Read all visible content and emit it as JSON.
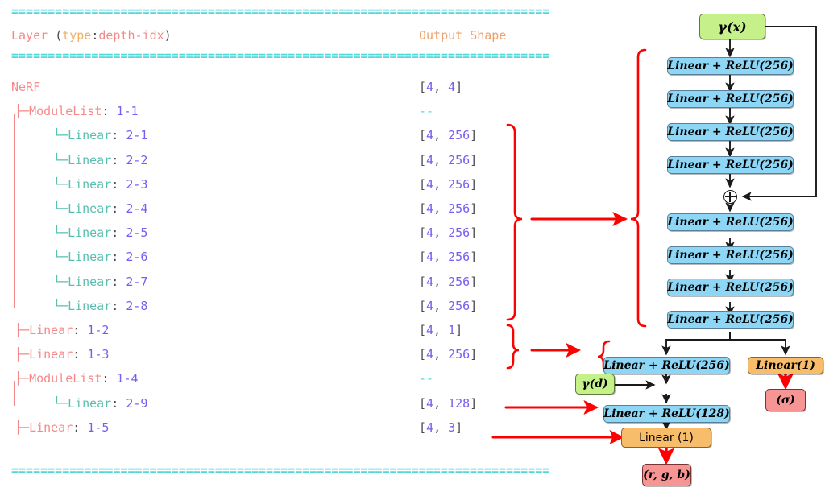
{
  "summary": {
    "divider": "==========================================================================",
    "header": {
      "layer": "Layer",
      "paren_open": "(",
      "type": "type",
      "colon": ":",
      "depth_idx": "depth-idx",
      "paren_close": ")",
      "output_shape": "Output Shape"
    },
    "rows": [
      {
        "indent": 0,
        "glyph": "",
        "name": "NeRF",
        "sep": "",
        "idx": "",
        "shape": "[4, 4]"
      },
      {
        "indent": 1,
        "glyph": "├─",
        "name": "ModuleList",
        "sep": ":",
        "idx": "1-1",
        "shape": "--"
      },
      {
        "indent": 2,
        "glyph": "└─",
        "name": "Linear",
        "sep": ":",
        "idx": "2-1",
        "shape": "[4, 256]"
      },
      {
        "indent": 2,
        "glyph": "└─",
        "name": "Linear",
        "sep": ":",
        "idx": "2-2",
        "shape": "[4, 256]"
      },
      {
        "indent": 2,
        "glyph": "└─",
        "name": "Linear",
        "sep": ":",
        "idx": "2-3",
        "shape": "[4, 256]"
      },
      {
        "indent": 2,
        "glyph": "└─",
        "name": "Linear",
        "sep": ":",
        "idx": "2-4",
        "shape": "[4, 256]"
      },
      {
        "indent": 2,
        "glyph": "└─",
        "name": "Linear",
        "sep": ":",
        "idx": "2-5",
        "shape": "[4, 256]"
      },
      {
        "indent": 2,
        "glyph": "└─",
        "name": "Linear",
        "sep": ":",
        "idx": "2-6",
        "shape": "[4, 256]"
      },
      {
        "indent": 2,
        "glyph": "└─",
        "name": "Linear",
        "sep": ":",
        "idx": "2-7",
        "shape": "[4, 256]"
      },
      {
        "indent": 2,
        "glyph": "└─",
        "name": "Linear",
        "sep": ":",
        "idx": "2-8",
        "shape": "[4, 256]"
      },
      {
        "indent": 1,
        "glyph": "├─",
        "name": "Linear",
        "sep": ":",
        "idx": "1-2",
        "shape": "[4, 1]"
      },
      {
        "indent": 1,
        "glyph": "├─",
        "name": "Linear",
        "sep": ":",
        "idx": "1-3",
        "shape": "[4, 256]"
      },
      {
        "indent": 1,
        "glyph": "├─",
        "name": "ModuleList",
        "sep": ":",
        "idx": "1-4",
        "shape": "--"
      },
      {
        "indent": 2,
        "glyph": "└─",
        "name": "Linear",
        "sep": ":",
        "idx": "2-9",
        "shape": "[4, 128]"
      },
      {
        "indent": 1,
        "glyph": "├─",
        "name": "Linear",
        "sep": ":",
        "idx": "1-5",
        "shape": "[4, 3]"
      }
    ]
  },
  "diagram": {
    "nodes": [
      {
        "id": "gamma_x",
        "label": "γ(x)"
      },
      {
        "id": "lin1",
        "label": "Linear + ReLU(256)"
      },
      {
        "id": "lin2",
        "label": "Linear + ReLU(256)"
      },
      {
        "id": "lin3",
        "label": "Linear + ReLU(256)"
      },
      {
        "id": "lin4",
        "label": "Linear + ReLU(256)"
      },
      {
        "id": "lin5",
        "label": "Linear + ReLU(256)"
      },
      {
        "id": "lin6",
        "label": "Linear + ReLU(256)"
      },
      {
        "id": "lin7",
        "label": "Linear + ReLU(256)"
      },
      {
        "id": "lin8",
        "label": "Linear + ReLU(256)"
      },
      {
        "id": "lin9",
        "label": "Linear + ReLU(256)"
      },
      {
        "id": "sigma_head",
        "label": "Linear(1)"
      },
      {
        "id": "sigma_out",
        "label": "(σ)"
      },
      {
        "id": "gamma_d",
        "label": "γ(d)"
      },
      {
        "id": "lin128",
        "label": "Linear + ReLU(128)"
      },
      {
        "id": "rgb_head",
        "label": "Linear (1)"
      },
      {
        "id": "rgb_out",
        "label": "(r, g, b)"
      }
    ]
  },
  "colors": {
    "blue": "#8ed6f5",
    "green": "#c6f08a",
    "orange": "#f8bd6a",
    "red": "#f79494",
    "annotation_red": "#ff0000",
    "cyan": "#4fd8d8",
    "pink": "#f58a8a",
    "purple": "#7b5cf0"
  }
}
